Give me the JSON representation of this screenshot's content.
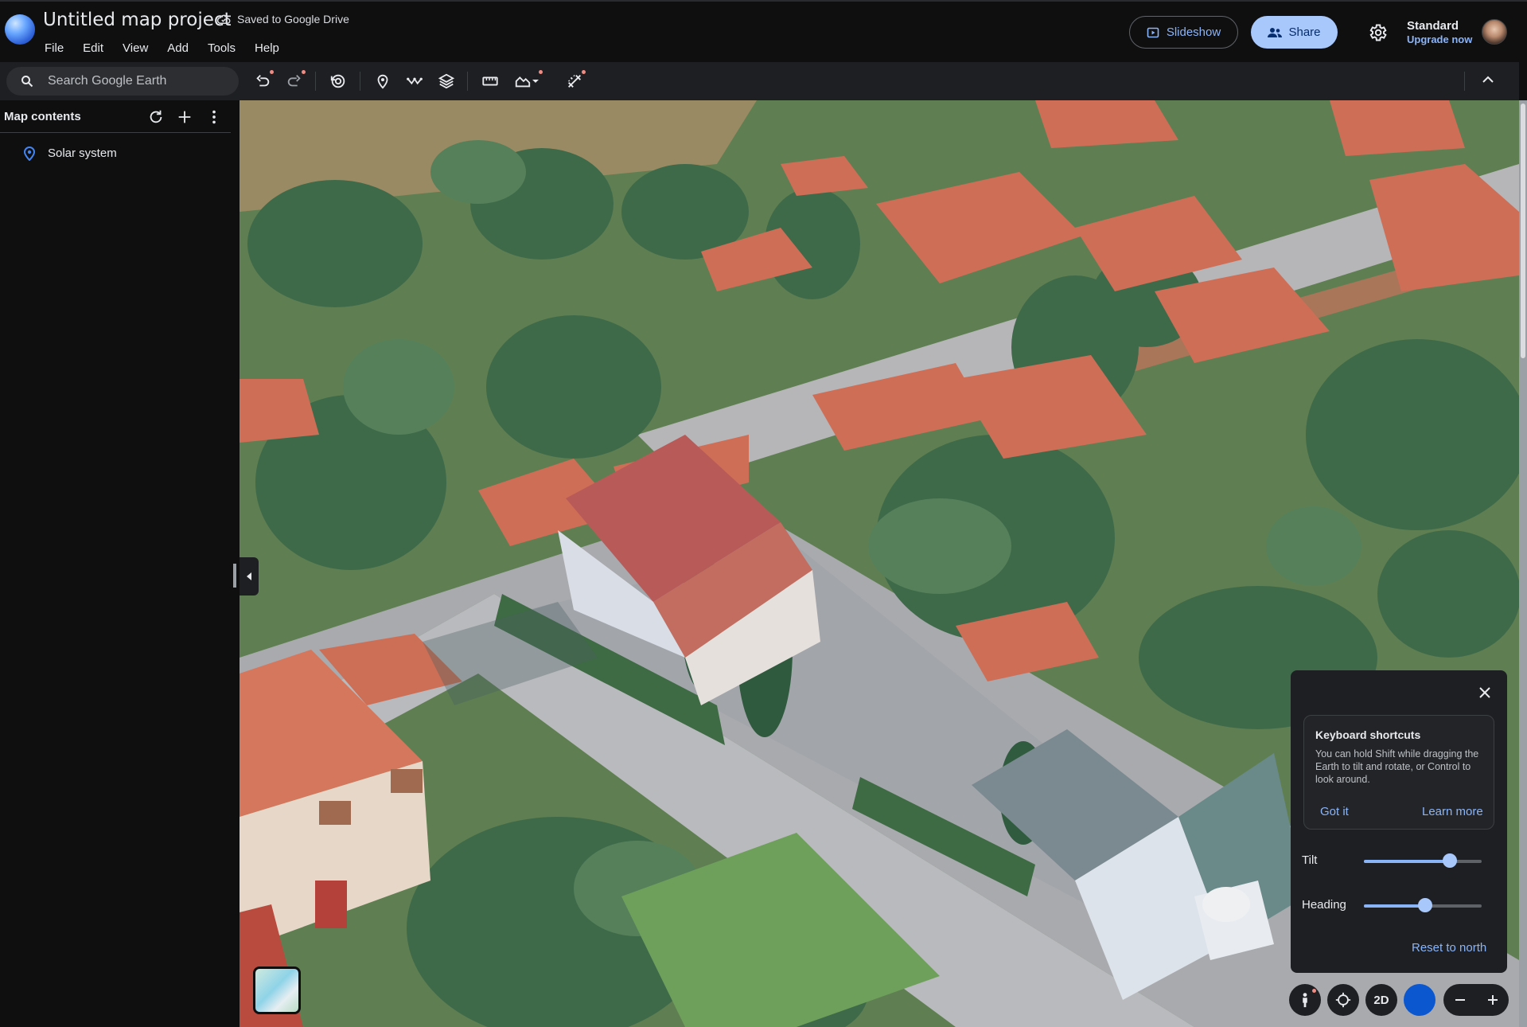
{
  "header": {
    "title": "Untitled map project",
    "saved_status": "Saved to Google Drive",
    "menu": [
      "File",
      "Edit",
      "View",
      "Add",
      "Tools",
      "Help"
    ],
    "slideshow_label": "Slideshow",
    "share_label": "Share",
    "plan_name": "Standard",
    "upgrade_label": "Upgrade now"
  },
  "toolbar": {
    "search_placeholder": "Search Google Earth",
    "tools": [
      "undo-icon",
      "redo-icon",
      "history-icon",
      "add-placemark-icon",
      "add-path-icon",
      "add-layer-icon",
      "measure-icon",
      "import-data-icon",
      "data-tools-icon"
    ]
  },
  "sidebar": {
    "heading": "Map contents",
    "items": [
      {
        "label": "Solar system",
        "icon": "placemark-icon"
      }
    ]
  },
  "nav_panel": {
    "tip_title": "Keyboard shortcuts",
    "tip_body": "You can hold Shift while dragging the Earth to tilt and rotate, or Control to look around.",
    "got_it": "Got it",
    "learn_more": "Learn more",
    "tilt_label": "Tilt",
    "tilt_value": 0.73,
    "heading_label": "Heading",
    "heading_value": 0.52,
    "reset_label": "Reset to north"
  },
  "controls": {
    "view_mode_label": "2D"
  },
  "colors": {
    "accent": "#8ab4f8",
    "share_bg": "#a8c7fa",
    "panel_bg": "#1e1f22",
    "app_bg": "#0f0f10"
  }
}
